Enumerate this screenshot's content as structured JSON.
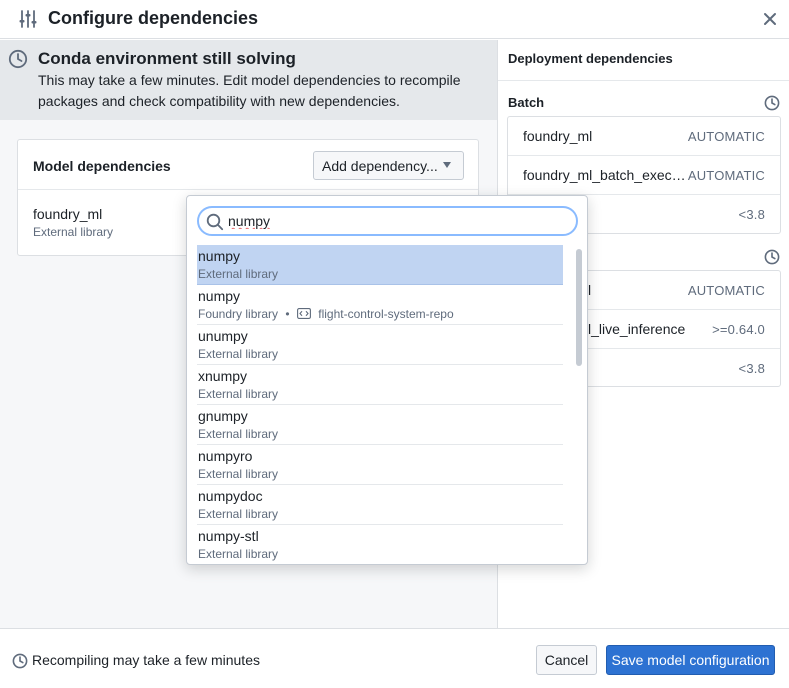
{
  "dialog": {
    "title": "Configure dependencies"
  },
  "banner": {
    "title": "Conda environment still solving",
    "text": "This may take a few minutes. Edit model dependencies to recompile packages and check compatibility with new dependencies."
  },
  "model_dependencies": {
    "title": "Model dependencies",
    "add_button": "Add dependency...",
    "items": [
      {
        "name": "foundry_ml",
        "type": "External library"
      }
    ]
  },
  "deployment": {
    "title": "Deployment dependencies",
    "batch": {
      "label": "Batch",
      "rows": [
        {
          "name": "foundry_ml",
          "value": "AUTOMATIC"
        },
        {
          "name": "foundry_ml_batch_execut...",
          "value": "AUTOMATIC"
        },
        {
          "name": "",
          "value": "<3.8"
        }
      ]
    },
    "live": {
      "rows": [
        {
          "name": "l",
          "value": "AUTOMATIC"
        },
        {
          "name": "l_live_inference",
          "value": ">=0.64.0"
        },
        {
          "name": "",
          "value": "<3.8"
        }
      ]
    }
  },
  "search": {
    "value": "numpy"
  },
  "results": [
    {
      "name": "numpy",
      "type": "External library",
      "selected": true
    },
    {
      "name": "numpy",
      "type": "Foundry library",
      "repo": "flight-control-system-repo",
      "separator": "•"
    },
    {
      "name": "unumpy",
      "type": "External library"
    },
    {
      "name": "xnumpy",
      "type": "External library"
    },
    {
      "name": "gnumpy",
      "type": "External library"
    },
    {
      "name": "numpyro",
      "type": "External library"
    },
    {
      "name": "numpydoc",
      "type": "External library"
    },
    {
      "name": "numpy-stl",
      "type": "External library"
    }
  ],
  "footer": {
    "status": "Recompiling may take a few minutes",
    "cancel": "Cancel",
    "save": "Save model configuration"
  },
  "colors": {
    "primary": "#2d72d2",
    "selected_row": "#c0d4f2",
    "banner_bg": "#e5e8eb",
    "search_border": "#8abbff"
  },
  "icons": {
    "header": "sliders-icon",
    "close": "close-icon",
    "clock": "clock-icon",
    "search": "search-icon",
    "repo": "code-repo-icon",
    "caret": "caret-down-icon"
  }
}
